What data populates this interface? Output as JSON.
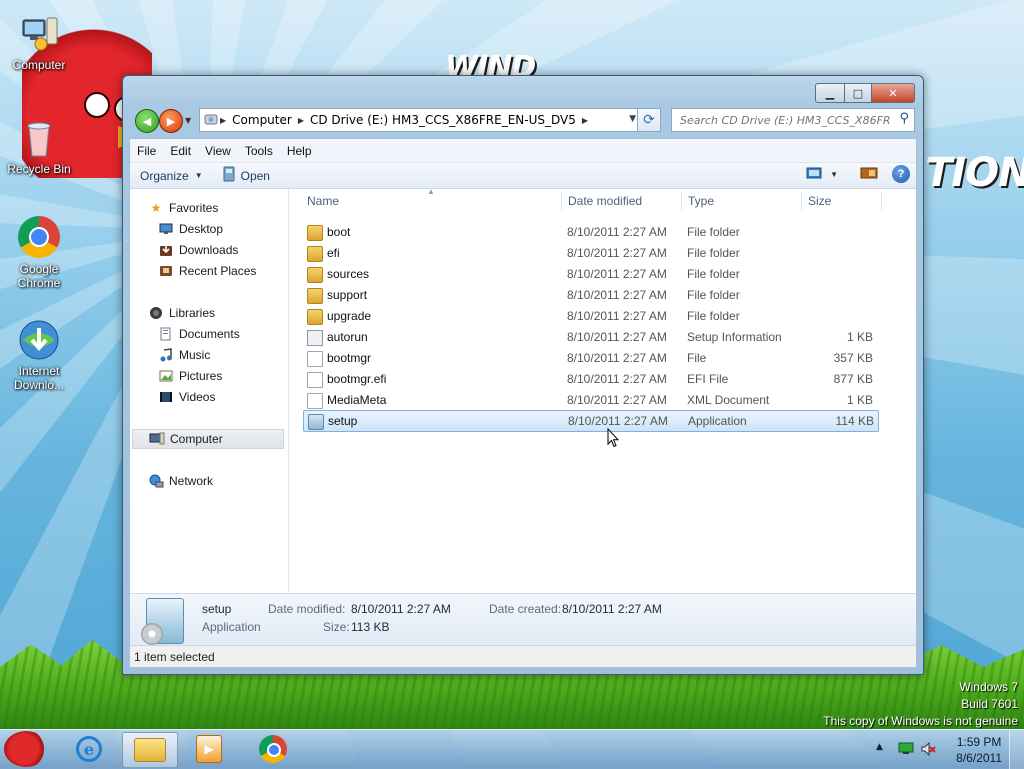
{
  "desktop": {
    "icons": [
      {
        "label": "Computer"
      },
      {
        "label": "Recycle Bin"
      },
      {
        "label": "Google Chrome"
      },
      {
        "label": "Internet Downlo..."
      }
    ],
    "wordmark_left": "WIND",
    "wordmark_right": "TION",
    "watermark": {
      "line1": "Windows 7",
      "line2": "Build 7601",
      "line3": "This copy of Windows is not genuine"
    }
  },
  "window": {
    "address": {
      "crumbs": [
        "Computer",
        "CD Drive (E:) HM3_CCS_X86FRE_EN-US_DV5"
      ]
    },
    "search": {
      "placeholder": "Search CD Drive (E:) HM3_CCS_X86FR..."
    },
    "menu": [
      "File",
      "Edit",
      "View",
      "Tools",
      "Help"
    ],
    "toolbar": {
      "organize": "Organize",
      "open": "Open"
    },
    "nav": {
      "favorites": "Favorites",
      "favorites_items": [
        "Desktop",
        "Downloads",
        "Recent Places"
      ],
      "libraries": "Libraries",
      "libraries_items": [
        "Documents",
        "Music",
        "Pictures",
        "Videos"
      ],
      "computer": "Computer",
      "network": "Network"
    },
    "columns": {
      "name": "Name",
      "date": "Date modified",
      "type": "Type",
      "size": "Size"
    },
    "files": [
      {
        "name": "boot",
        "date": "8/10/2011 2:27 AM",
        "type": "File folder",
        "size": "",
        "kind": "folder"
      },
      {
        "name": "efi",
        "date": "8/10/2011 2:27 AM",
        "type": "File folder",
        "size": "",
        "kind": "folder"
      },
      {
        "name": "sources",
        "date": "8/10/2011 2:27 AM",
        "type": "File folder",
        "size": "",
        "kind": "folder"
      },
      {
        "name": "support",
        "date": "8/10/2011 2:27 AM",
        "type": "File folder",
        "size": "",
        "kind": "folder"
      },
      {
        "name": "upgrade",
        "date": "8/10/2011 2:27 AM",
        "type": "File folder",
        "size": "",
        "kind": "folder"
      },
      {
        "name": "autorun",
        "date": "8/10/2011 2:27 AM",
        "type": "Setup Information",
        "size": "1 KB",
        "kind": "info"
      },
      {
        "name": "bootmgr",
        "date": "8/10/2011 2:27 AM",
        "type": "File",
        "size": "357 KB",
        "kind": "file"
      },
      {
        "name": "bootmgr.efi",
        "date": "8/10/2011 2:27 AM",
        "type": "EFI File",
        "size": "877 KB",
        "kind": "file"
      },
      {
        "name": "MediaMeta",
        "date": "8/10/2011 2:27 AM",
        "type": "XML Document",
        "size": "1 KB",
        "kind": "file"
      },
      {
        "name": "setup",
        "date": "8/10/2011 2:27 AM",
        "type": "Application",
        "size": "114 KB",
        "kind": "setup",
        "selected": true
      }
    ],
    "details": {
      "name": "setup",
      "type": "Application",
      "date_modified_label": "Date modified:",
      "date_modified": "8/10/2011 2:27 AM",
      "date_created_label": "Date created:",
      "date_created": "8/10/2011 2:27 AM",
      "size_label": "Size:",
      "size": "113 KB"
    },
    "status": "1 item selected"
  },
  "taskbar": {
    "time": "1:59 PM",
    "date": "8/6/2011"
  },
  "colors": {
    "selection_fill": "#cde4f8",
    "selection_border": "#7fb1e0",
    "close_button": "#c9442b"
  }
}
